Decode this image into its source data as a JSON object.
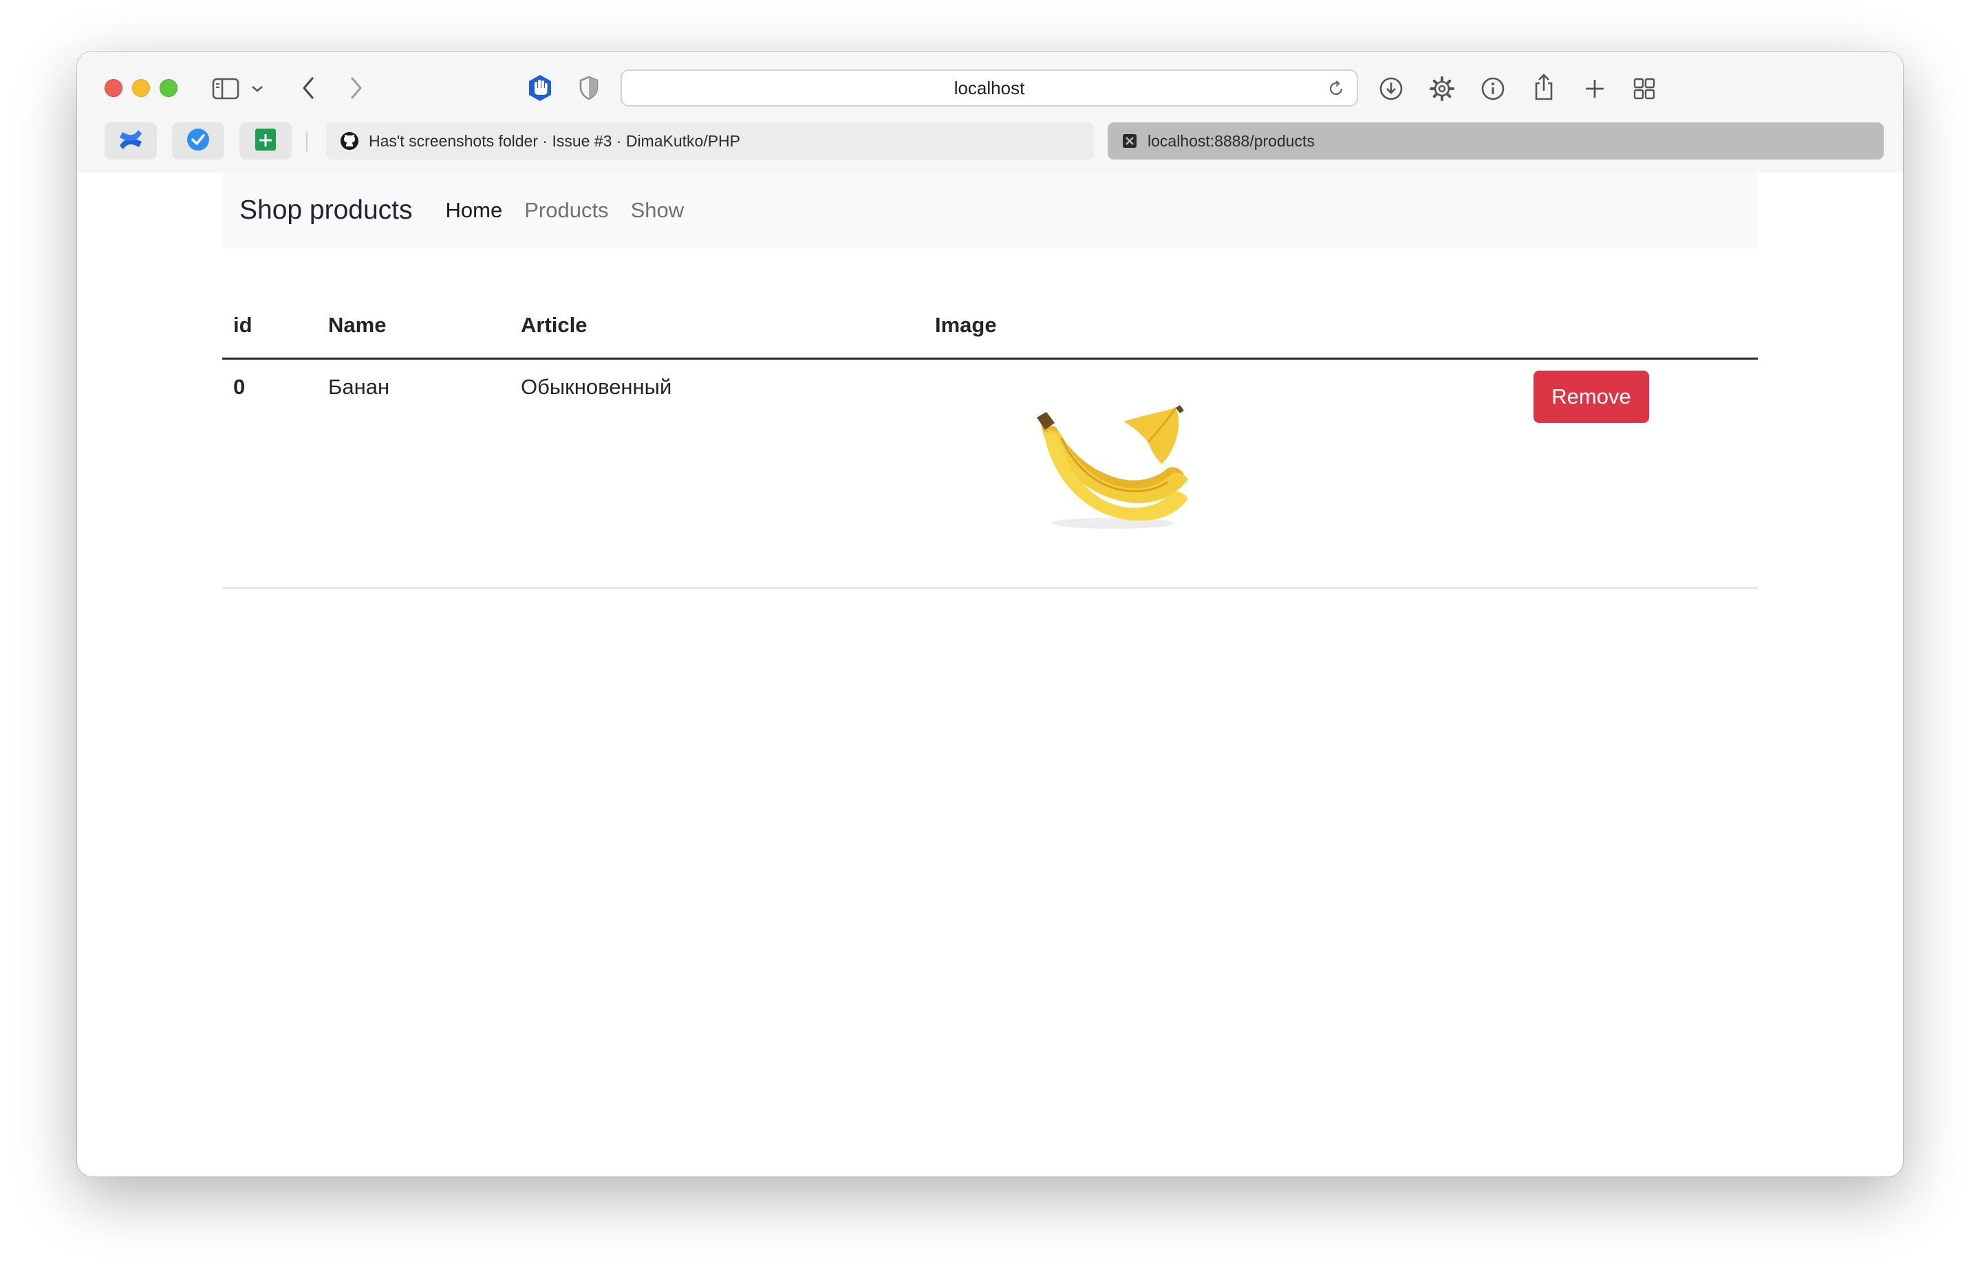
{
  "browser": {
    "address": "localhost",
    "tabs": [
      {
        "title": "Has't screenshots folder · Issue #3 · DimaKutko/PHP",
        "favicon": "github-icon",
        "active": false
      },
      {
        "title": "localhost:8888/products",
        "favicon": "close-icon",
        "active": true
      }
    ],
    "favorites": [
      "confluence-icon",
      "tasks-check-icon",
      "sheets-icon"
    ],
    "colors": {
      "toolbar": "#f6f6f6",
      "active_tab": "#bcbcbc",
      "inactive_tab": "#ececec"
    }
  },
  "navbar": {
    "brand": "Shop products",
    "links": [
      {
        "label": "Home",
        "active": true
      },
      {
        "label": "Products",
        "active": false
      },
      {
        "label": "Show",
        "active": false
      }
    ]
  },
  "table": {
    "headers": [
      "id",
      "Name",
      "Article",
      "Image"
    ],
    "rows": [
      {
        "id": "0",
        "name": "Банан",
        "article": "Обыкновенный",
        "image": "banana-image",
        "action": "Remove"
      }
    ]
  },
  "colors": {
    "danger": "#dc3545",
    "navbar_bg": "#f8f9fa",
    "text": "#212529"
  }
}
